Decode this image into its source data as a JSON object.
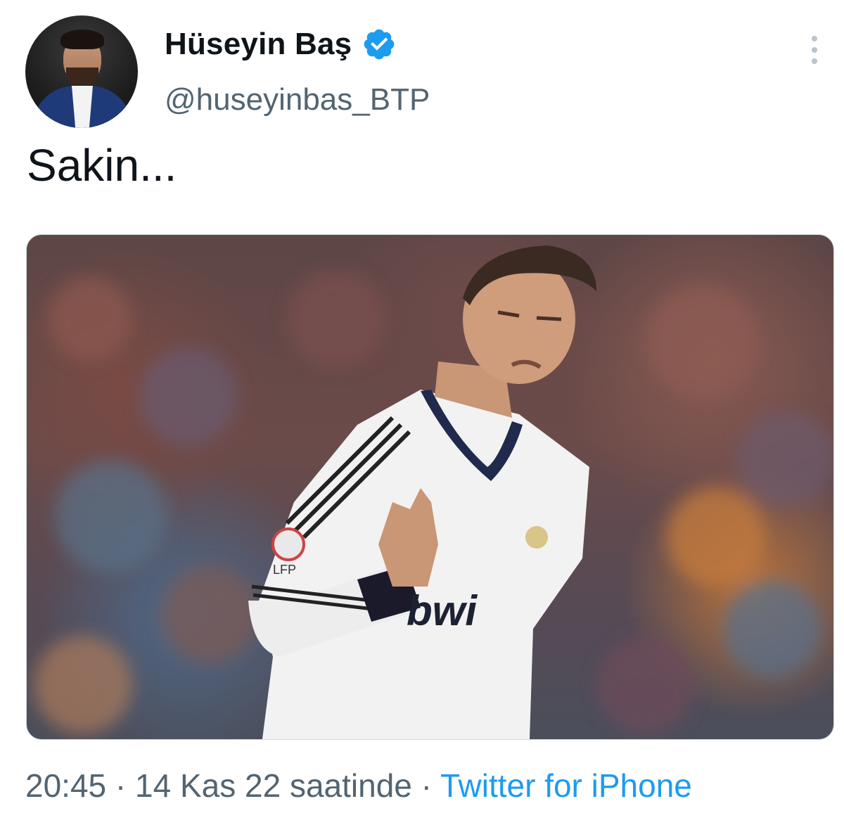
{
  "tweet": {
    "author": {
      "display_name": "Hüseyin Baş",
      "handle": "@huseyinbas_BTP",
      "verified": true
    },
    "text": "Sakin...",
    "media": {
      "type": "photo",
      "jersey_text": "bwi",
      "patch_text": "LFP"
    },
    "meta": {
      "time": "20:45",
      "separator": "·",
      "date": "14 Kas 22 saatinde",
      "source": "Twitter for iPhone"
    }
  },
  "icons": {
    "verified": "verified-badge-icon",
    "more": "more-options-icon"
  },
  "colors": {
    "text_primary": "#0f1419",
    "text_secondary": "#536471",
    "accent": "#1d9bf0"
  }
}
